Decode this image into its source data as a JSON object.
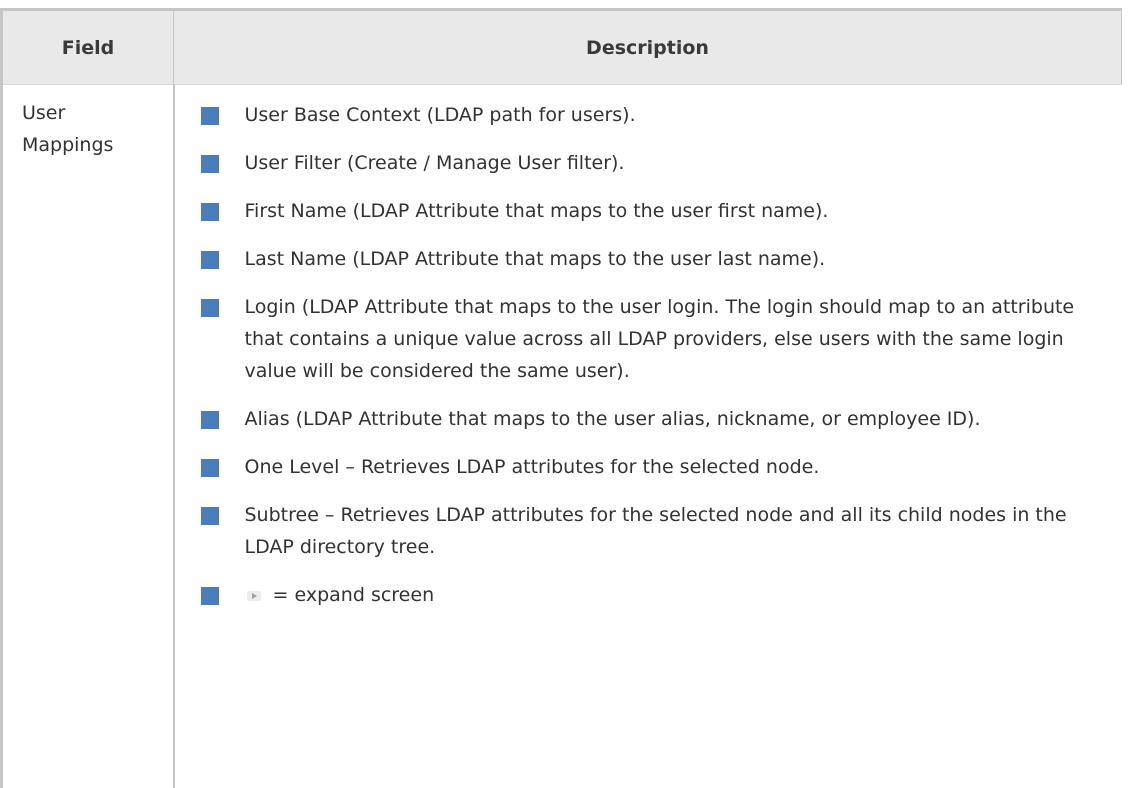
{
  "table": {
    "headers": {
      "field": "Field",
      "description": "Description"
    },
    "row": {
      "field_label": "User Mappings",
      "items": [
        "User Base Context (LDAP path for users).",
        "User Filter (Create / Manage User filter).",
        "First Name (LDAP Attribute that maps to the user first name).",
        "Last Name (LDAP Attribute that maps to the user last name).",
        "Login (LDAP Attribute that maps to the user login. The login should map to an attribute that contains a unique value across all LDAP providers, else users with the same login value will be considered the same user).",
        "Alias (LDAP Attribute that maps to the user alias, nickname, or employee ID).",
        "One Level – Retrieves LDAP attributes for the selected node.",
        "Subtree – Retrieves LDAP attributes for the selected node and all its child nodes in the LDAP directory tree."
      ],
      "last_item": {
        "icon": "expand-arrow-icon",
        "text": " = expand screen"
      }
    }
  },
  "colors": {
    "bullet": "#4a7ebb",
    "header_bg": "#e9e9e9",
    "border": "#c6c6c6",
    "text": "#333333"
  }
}
